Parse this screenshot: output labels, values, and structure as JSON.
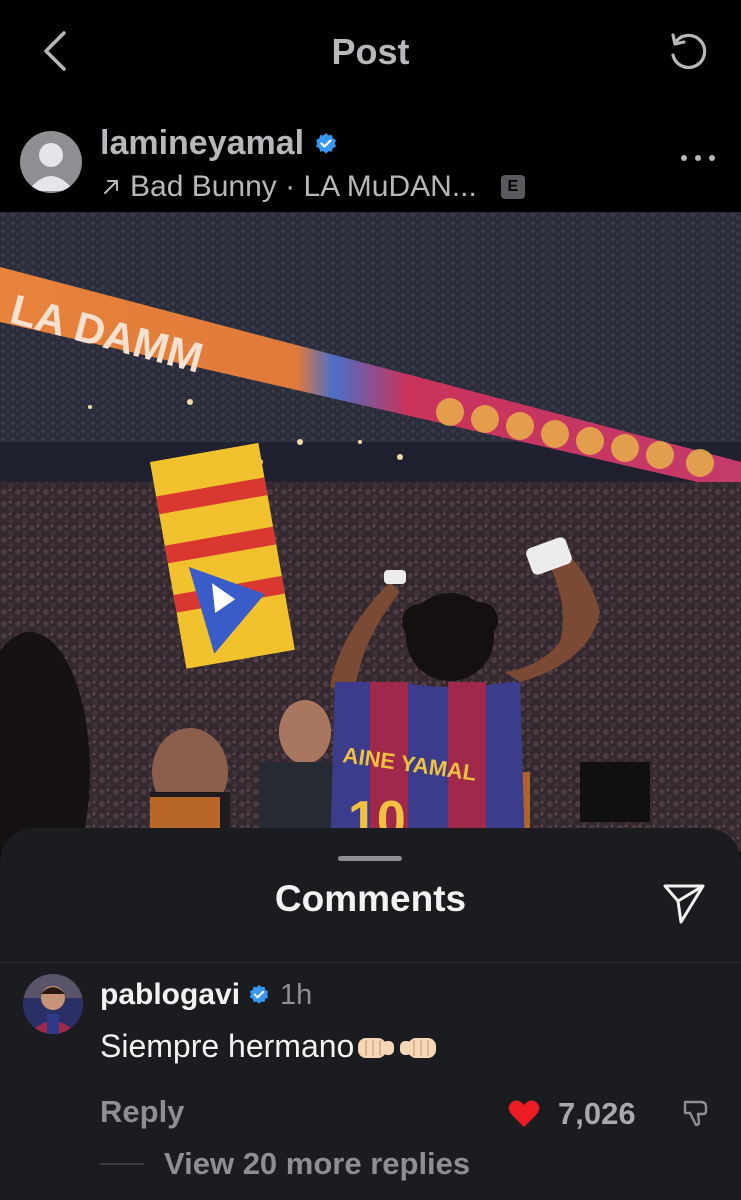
{
  "header": {
    "title": "Post",
    "back_icon": "chevron-left-icon",
    "refresh_icon": "refresh-icon"
  },
  "post": {
    "username": "lamineyamal",
    "verified": true,
    "music": "Bad Bunny · LA MuDAN...",
    "explicit_badge": "E",
    "more_icon": "more-horizontal-icon"
  },
  "photo": {
    "jersey_name": "AINE YAMAL",
    "jersey_number": "10",
    "banner_text": "LA DAMM"
  },
  "comments_sheet": {
    "title": "Comments",
    "share_icon": "send-icon",
    "comments": [
      {
        "username": "pablogavi",
        "verified": true,
        "time": "1h",
        "text": "Siempre hermano",
        "reply_label": "Reply",
        "like_count": "7,026",
        "view_replies": "View 20 more replies"
      }
    ]
  },
  "colors": {
    "background": "#000000",
    "sheet": "#1b1c1f",
    "verified_blue": "#3897f0",
    "like_red": "#ed1c24",
    "muted_text": "#8e8e93"
  }
}
